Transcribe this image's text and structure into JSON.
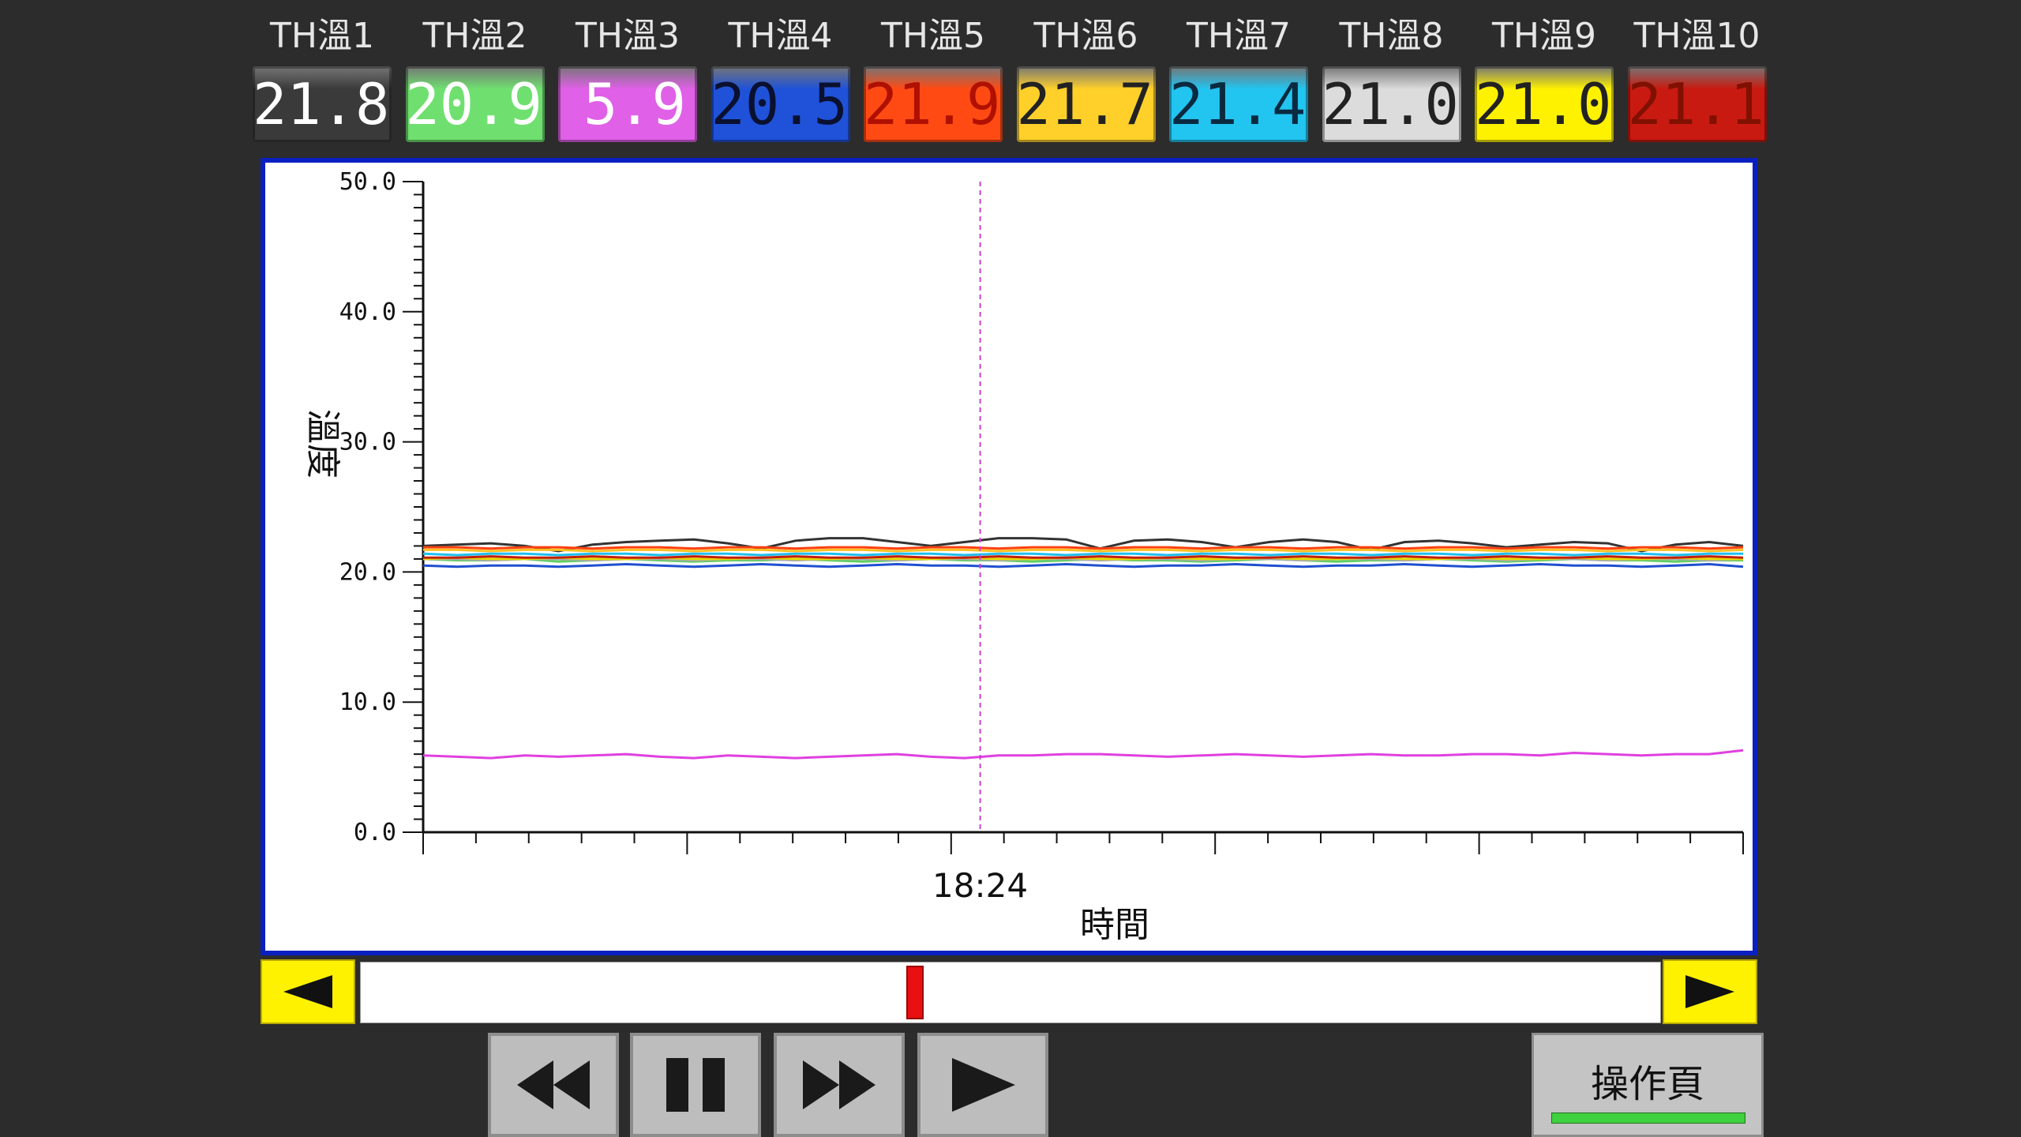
{
  "channels": [
    {
      "label": "TH溫1",
      "value": "21.8",
      "bg": "#3a3a3a",
      "fg": "#ffffff"
    },
    {
      "label": "TH溫2",
      "value": "20.9",
      "bg": "#6fe06f",
      "fg": "#ffffff"
    },
    {
      "label": "TH溫3",
      "value": "5.9",
      "bg": "#e060e8",
      "fg": "#ffffff"
    },
    {
      "label": "TH溫4",
      "value": "20.5",
      "bg": "#1f52d8",
      "fg": "#0a1030"
    },
    {
      "label": "TH溫5",
      "value": "21.9",
      "bg": "#ff4a14",
      "fg": "#b01000"
    },
    {
      "label": "TH溫6",
      "value": "21.7",
      "bg": "#ffd02a",
      "fg": "#222222"
    },
    {
      "label": "TH溫7",
      "value": "21.4",
      "bg": "#22c4f0",
      "fg": "#0a2a40"
    },
    {
      "label": "TH溫8",
      "value": "21.0",
      "bg": "#dcdcdc",
      "fg": "#222222"
    },
    {
      "label": "TH溫9",
      "value": "21.0",
      "bg": "#fff200",
      "fg": "#222222"
    },
    {
      "label": "TH溫10",
      "value": "21.1",
      "bg": "#c81a10",
      "fg": "#801000"
    }
  ],
  "chart_data": {
    "type": "line",
    "ylabel": "溫度",
    "xlabel": "時間",
    "ylim": [
      0,
      50
    ],
    "yticks": [
      "0.0",
      "10.0",
      "20.0",
      "30.0",
      "40.0",
      "50.0"
    ],
    "x_tick_label": "18:24",
    "grid": false,
    "cursor_fraction": 0.422,
    "series": [
      {
        "color": "#333333",
        "values": [
          22.0,
          22.1,
          22.2,
          22.0,
          21.6,
          22.1,
          22.3,
          22.4,
          22.5,
          22.2,
          21.8,
          22.4,
          22.6,
          22.6,
          22.3,
          22.0,
          22.3,
          22.6,
          22.6,
          22.5,
          21.8,
          22.4,
          22.5,
          22.3,
          21.9,
          22.3,
          22.5,
          22.3,
          21.7,
          22.3,
          22.4,
          22.2,
          21.9,
          22.1,
          22.3,
          22.2,
          21.6,
          22.1,
          22.3,
          22.0
        ]
      },
      {
        "color": "#60d060",
        "values": [
          21.0,
          20.9,
          20.9,
          21.0,
          20.8,
          20.9,
          21.0,
          20.9,
          20.8,
          20.9,
          20.9,
          21.0,
          20.9,
          20.8,
          20.9,
          21.0,
          20.9,
          20.9,
          20.8,
          20.9,
          21.0,
          20.9,
          20.9,
          20.8,
          20.9,
          21.0,
          20.9,
          20.8,
          20.9,
          20.9,
          21.0,
          20.9,
          20.8,
          20.9,
          21.0,
          20.9,
          20.9,
          20.8,
          20.9,
          20.9
        ]
      },
      {
        "color": "#e040e0",
        "values": [
          5.9,
          5.8,
          5.7,
          5.9,
          5.8,
          5.9,
          6.0,
          5.8,
          5.7,
          5.9,
          5.8,
          5.7,
          5.8,
          5.9,
          6.0,
          5.8,
          5.7,
          5.9,
          5.9,
          6.0,
          6.0,
          5.9,
          5.8,
          5.9,
          6.0,
          5.9,
          5.8,
          5.9,
          6.0,
          5.9,
          5.9,
          6.0,
          6.0,
          5.9,
          6.1,
          6.0,
          5.9,
          6.0,
          6.0,
          6.3
        ]
      },
      {
        "color": "#2050d0",
        "values": [
          20.5,
          20.4,
          20.5,
          20.5,
          20.4,
          20.5,
          20.6,
          20.5,
          20.4,
          20.5,
          20.6,
          20.5,
          20.4,
          20.5,
          20.6,
          20.5,
          20.5,
          20.4,
          20.5,
          20.6,
          20.5,
          20.4,
          20.5,
          20.5,
          20.6,
          20.5,
          20.4,
          20.5,
          20.5,
          20.6,
          20.5,
          20.4,
          20.5,
          20.6,
          20.5,
          20.5,
          20.4,
          20.5,
          20.6,
          20.4
        ]
      },
      {
        "color": "#ff4010",
        "values": [
          21.9,
          21.9,
          21.8,
          21.9,
          21.9,
          21.8,
          21.9,
          21.9,
          21.8,
          21.9,
          21.9,
          21.8,
          21.9,
          21.9,
          21.8,
          21.9,
          21.9,
          21.8,
          21.9,
          21.9,
          21.8,
          21.9,
          21.9,
          21.8,
          21.9,
          21.9,
          21.8,
          21.9,
          21.9,
          21.8,
          21.9,
          21.9,
          21.8,
          21.9,
          21.9,
          21.8,
          21.9,
          21.9,
          21.8,
          21.9
        ]
      },
      {
        "color": "#ffc020",
        "values": [
          21.7,
          21.7,
          21.6,
          21.7,
          21.7,
          21.6,
          21.7,
          21.7,
          21.6,
          21.7,
          21.7,
          21.6,
          21.7,
          21.7,
          21.6,
          21.7,
          21.7,
          21.6,
          21.7,
          21.7,
          21.6,
          21.7,
          21.7,
          21.6,
          21.7,
          21.7,
          21.6,
          21.7,
          21.7,
          21.6,
          21.7,
          21.7,
          21.6,
          21.7,
          21.7,
          21.6,
          21.7,
          21.7,
          21.6,
          21.7
        ]
      },
      {
        "color": "#20c0f0",
        "values": [
          21.4,
          21.3,
          21.4,
          21.4,
          21.3,
          21.4,
          21.4,
          21.3,
          21.4,
          21.4,
          21.3,
          21.4,
          21.4,
          21.3,
          21.4,
          21.4,
          21.3,
          21.4,
          21.4,
          21.3,
          21.4,
          21.4,
          21.3,
          21.4,
          21.4,
          21.3,
          21.4,
          21.4,
          21.3,
          21.4,
          21.4,
          21.3,
          21.4,
          21.4,
          21.3,
          21.4,
          21.4,
          21.3,
          21.4,
          21.4
        ]
      },
      {
        "color": "#aaaaaa",
        "values": [
          21.0,
          21.0,
          20.9,
          21.0,
          21.0,
          20.9,
          21.0,
          21.0,
          20.9,
          21.0,
          21.0,
          20.9,
          21.0,
          21.0,
          20.9,
          21.0,
          21.0,
          20.9,
          21.0,
          21.0,
          20.9,
          21.0,
          21.0,
          20.9,
          21.0,
          21.0,
          20.9,
          21.0,
          21.0,
          20.9,
          21.0,
          21.0,
          20.9,
          21.0,
          21.0,
          20.9,
          21.0,
          21.0,
          20.9,
          21.0
        ]
      },
      {
        "color": "#e6d800",
        "values": [
          21.0,
          21.1,
          21.0,
          21.0,
          21.1,
          21.0,
          21.0,
          21.1,
          21.0,
          21.0,
          21.1,
          21.0,
          21.0,
          21.1,
          21.0,
          21.0,
          21.1,
          21.0,
          21.0,
          21.1,
          21.0,
          21.0,
          21.1,
          21.0,
          21.0,
          21.1,
          21.0,
          21.0,
          21.1,
          21.0,
          21.0,
          21.1,
          21.0,
          21.0,
          21.1,
          21.0,
          21.0,
          21.1,
          21.0,
          21.0
        ]
      },
      {
        "color": "#c02010",
        "values": [
          21.1,
          21.1,
          21.2,
          21.1,
          21.1,
          21.2,
          21.1,
          21.1,
          21.2,
          21.1,
          21.1,
          21.2,
          21.1,
          21.1,
          21.2,
          21.1,
          21.1,
          21.2,
          21.1,
          21.1,
          21.2,
          21.1,
          21.1,
          21.2,
          21.1,
          21.1,
          21.2,
          21.1,
          21.1,
          21.2,
          21.1,
          21.1,
          21.2,
          21.1,
          21.1,
          21.2,
          21.1,
          21.1,
          21.2,
          21.1
        ]
      }
    ]
  },
  "scrollbar": {
    "position": 0.425
  },
  "controls": {
    "rewind_icon": "fast-rewind-icon",
    "pause_icon": "pause-icon",
    "fast_forward_icon": "fast-forward-icon",
    "play_icon": "play-icon"
  },
  "op_page": {
    "label": "操作頁"
  }
}
